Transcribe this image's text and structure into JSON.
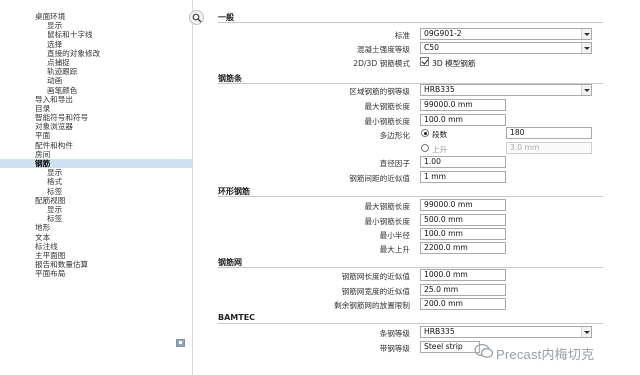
{
  "tree": {
    "items": [
      {
        "label": "桌面环境",
        "level": 0
      },
      {
        "label": "显示",
        "level": 1
      },
      {
        "label": "鼠标和十字线",
        "level": 1
      },
      {
        "label": "选择",
        "level": 1
      },
      {
        "label": "直接的对象修改",
        "level": 1
      },
      {
        "label": "点捕捉",
        "level": 1
      },
      {
        "label": "轨迹跟踪",
        "level": 1
      },
      {
        "label": "动画",
        "level": 1
      },
      {
        "label": "画笔颜色",
        "level": 1
      },
      {
        "label": "导入和导出",
        "level": 0
      },
      {
        "label": "目录",
        "level": 0
      },
      {
        "label": "智能符号和符号",
        "level": 0
      },
      {
        "label": "对象浏览器",
        "level": 0
      },
      {
        "label": "平面",
        "level": 0
      },
      {
        "label": "配件和构件",
        "level": 0
      },
      {
        "label": "房间",
        "level": 0
      },
      {
        "label": "钢筋",
        "level": 0,
        "selected": true
      },
      {
        "label": "显示",
        "level": 1
      },
      {
        "label": "格式",
        "level": 1
      },
      {
        "label": "标签",
        "level": 1
      },
      {
        "label": "配筋视图",
        "level": 0
      },
      {
        "label": "显示",
        "level": 1
      },
      {
        "label": "标签",
        "level": 1
      },
      {
        "label": "地形",
        "level": 0
      },
      {
        "label": "文本",
        "level": 0
      },
      {
        "label": "标注线",
        "level": 0
      },
      {
        "label": "主平面图",
        "level": 0
      },
      {
        "label": "报告和数量估算",
        "level": 0
      },
      {
        "label": "平面布局",
        "level": 0
      }
    ]
  },
  "general": {
    "title": "一般",
    "standard_label": "标准",
    "standard_value": "09G901-2",
    "concrete_label": "混凝土强度等级",
    "concrete_value": "C50",
    "mode_label": "2D/3D 钢筋模式",
    "mode_check_label": "3D 模型钢筋",
    "mode_checked": true
  },
  "bar": {
    "title": "钢筋条",
    "grade_label": "区域钢筋的钢等级",
    "grade_value": "HRB335",
    "max_len_label": "最大钢筋长度",
    "max_len_value": "99000.0 mm",
    "min_len_label": "最小钢筋长度",
    "min_len_value": "100.0 mm",
    "poly_label": "多边形化",
    "segments_label": "段数",
    "segments_value": "180",
    "rise_label": "上升",
    "rise_value": "3.0 mm",
    "segments_selected": true,
    "diameter_factor_label": "直径因子",
    "diameter_factor_value": "1.00",
    "approx_label": "钢筋间距的近似值",
    "approx_value": "1 mm"
  },
  "ring": {
    "title": "环形钢筋",
    "max_len_label": "最大钢筋长度",
    "max_len_value": "99000.0 mm",
    "min_len_label": "最小钢筋长度",
    "min_len_value": "500.0 mm",
    "min_radius_label": "最小半径",
    "min_radius_value": "100.0 mm",
    "max_rise_label": "最大上升",
    "max_rise_value": "2200.0 mm"
  },
  "mesh": {
    "title": "钢筋网",
    "len_label": "钢筋网长度的近似值",
    "len_value": "1000.0 mm",
    "width_label": "钢筋网宽度的近似值",
    "width_value": "25.0 mm",
    "limit_label": "剩余钢筋网的放置限制",
    "limit_value": "200.0 mm"
  },
  "bamtec": {
    "title": "BAMTEC",
    "grade_label": "条钢等级",
    "grade_value": "HRB335",
    "strip_label": "带钢等级",
    "strip_value": "Steel strip"
  },
  "watermark": {
    "text": "Precast内梅切克"
  },
  "icons": {
    "search": "search-icon",
    "collapse": "collapse-icon",
    "dropdown": "chevron-down-icon",
    "wechat": "wechat-icon"
  }
}
